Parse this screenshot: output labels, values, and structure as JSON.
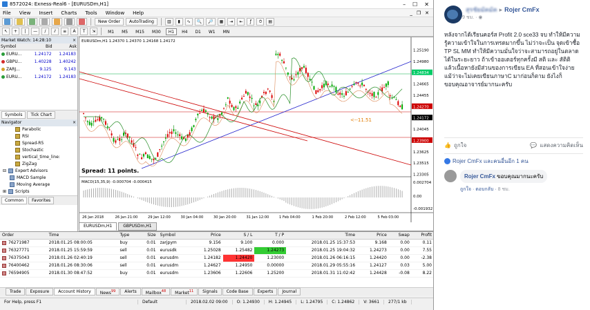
{
  "mt4": {
    "title": "8572024: Exness-Real6 - [EURUSDm,H1]",
    "menu": [
      "File",
      "View",
      "Insert",
      "Charts",
      "Tools",
      "Window",
      "Help"
    ],
    "toolbar": {
      "new_order": "New Order",
      "autotrading": "AutoTrading"
    },
    "timeframes": [
      "M1",
      "M5",
      "M15",
      "M30",
      "H1",
      "H4",
      "D1",
      "W1",
      "MN"
    ],
    "active_timeframe": "H1",
    "market_watch": {
      "title": "Market Watch: 14:28:10",
      "headers": {
        "symbol": "Symbol",
        "bid": "Bid",
        "ask": "Ask"
      },
      "rows": [
        {
          "symbol": "EURU...",
          "bid": "1.24172",
          "ask": "1.24183",
          "color": "#2a9d3a"
        },
        {
          "symbol": "GBPU...",
          "bid": "1.40228",
          "ask": "1.40242",
          "color": "#d42a2a"
        },
        {
          "symbol": "ZARJ...",
          "bid": "9.125",
          "ask": "9.143",
          "color": "#d4a22a"
        },
        {
          "symbol": "EURU...",
          "bid": "1.24172",
          "ask": "1.24183",
          "color": "#2a9d3a"
        }
      ],
      "tabs": [
        "Symbols",
        "Tick Chart"
      ]
    },
    "navigator": {
      "title": "Navigator",
      "indicators": [
        "Parabolic",
        "RSI",
        "Spread-R5",
        "Stochastic",
        "vertical_time_line:",
        "ZigZag"
      ],
      "expert_header": "Expert Advisors",
      "experts": [
        "MACD Sample",
        "Moving Average"
      ],
      "scripts": "Scripts",
      "tabs": [
        "Common",
        "Favorites"
      ]
    },
    "chart": {
      "header": "EURUSDm,H1  1.24370 1.24370 1.24168 1.24172",
      "spread": "Spread: 11 points.",
      "macd": "MACD(15,35,9) -0.000704 -0.000415",
      "annotation": "<--11.51",
      "price_ticks": [
        "1.25190",
        "1.24980",
        "1.24834",
        "1.24665",
        "1.24455",
        "1.24270",
        "1.24172",
        "1.24045",
        "1.23900",
        "1.23625",
        "1.23515",
        "1.23305"
      ],
      "macd_ticks": [
        "0.002704",
        "0.00",
        "-0.001932"
      ],
      "time_ticks": [
        "26 Jan 2018",
        "26 Jan 21:00",
        "29 Jan 12:00",
        "30 Jan 04:00",
        "30 Jan 20:00",
        "31 Jan 12:00",
        "1 Feb 04:00",
        "1 Feb 20:00",
        "2 Feb 12:00",
        "5 Feb 03:00"
      ],
      "tabs": [
        "EURUSDm,H1",
        "GBPUSDm,H1"
      ]
    },
    "terminal": {
      "headers": [
        "Order",
        "Time",
        "Type",
        "Size",
        "Symbol",
        "Price",
        "S / L",
        "T / P",
        "Time",
        "Price",
        "Swap",
        "Profit"
      ],
      "rows": [
        [
          "76271987",
          "2018.01.25 08:00:05",
          "buy",
          "0.01",
          "zarjpym",
          "9.156",
          "9.100",
          "0.000",
          "2018.01.25 15:37:53",
          "9.168",
          "0.00",
          "0.11"
        ],
        [
          "76327771",
          "2018.01.25 15:59:59",
          "sell",
          "0.01",
          "eurusdk",
          "1.25028",
          "1.25482",
          "1.24273",
          "2018.01.25 19:04:32",
          "1.24273",
          "0.00",
          "7.55"
        ],
        [
          "76375043",
          "2018.01.26 02:40:19",
          "sell",
          "0.01",
          "eurusdm",
          "1.24182",
          "1.24420",
          "1.23000",
          "2018.01.26 06:16:15",
          "1.24420",
          "0.00",
          "-2.38"
        ],
        [
          "76400462",
          "2018.01.26 08:30:06",
          "sell",
          "0.01",
          "eurusdm",
          "1.24627",
          "1.24950",
          "0.00000",
          "2018.01.29 05:55:16",
          "1.24127",
          "0.03",
          "5.00"
        ],
        [
          "76594905",
          "2018.01.30 08:47:52",
          "buy",
          "0.01",
          "eurusdm",
          "1.23606",
          "1.22606",
          "1.25200",
          "2018.01.31 11:02:42",
          "1.24428",
          "-0.08",
          "8.22"
        ]
      ],
      "tabs": [
        {
          "label": "Trade",
          "badge": ""
        },
        {
          "label": "Exposure",
          "badge": ""
        },
        {
          "label": "Account History",
          "badge": ""
        },
        {
          "label": "News",
          "badge": "99"
        },
        {
          "label": "Alerts",
          "badge": ""
        },
        {
          "label": "Mailbox",
          "badge": "48"
        },
        {
          "label": "Market",
          "badge": "11"
        },
        {
          "label": "Signals",
          "badge": ""
        },
        {
          "label": "Code Base",
          "badge": ""
        },
        {
          "label": "Experts",
          "badge": ""
        },
        {
          "label": "Journal",
          "badge": ""
        }
      ]
    },
    "status": {
      "help": "For Help, press F1",
      "profile": "Default",
      "time": "2018.02.02 09:00",
      "o": "O: 1.24930",
      "h": "H: 1.24945",
      "l": "L: 1.24795",
      "c": "C: 1.24862",
      "v": "V: 3661",
      "conn": "277/1 kb"
    }
  },
  "facebook": {
    "author_blurred": "สุรชัยมัคมัค",
    "page_name": "Rojer CmFx",
    "meta": "9 ชม. ·",
    "post_text": "หลังจากได้เรียนคอร์ส Profit 2.0 sce33 จบ ทำให้มีความรู้ความเข้าใจในการเทรดมากขึ้น ไม่ว่าจะเป็น จุดเข้าซื้อ TP SL MM ทำให้มีความมั่นใจว่าจะสามารถอยู่ในตลาดได้ในระยะยาว ถ้าเข้าออเดอร์ทุกครั้งมี สติ และ สัติติ แล้วเนื้อหายังมีส่วนของการเขียน EA ที่สอนเข้าใจง่ายแม้ว่าจะไม่เคยเขียนภาษาC มาก่อนก็ตาม ยังไงก็ขอบคุณอาจารย์มากนะครับ",
    "like": "ถูกใจ",
    "comment": "แสดงความคิดเห็น",
    "liked_by": "Rojer CmFx และคนอื่นอีก 1 คน",
    "comment_author": "Rojer CmFx",
    "comment_text": "ขอบคุณมากนะครับ",
    "comment_like": "ถูกใจ",
    "comment_reply": "ตอบกลับ",
    "comment_time": "8 ชม."
  }
}
